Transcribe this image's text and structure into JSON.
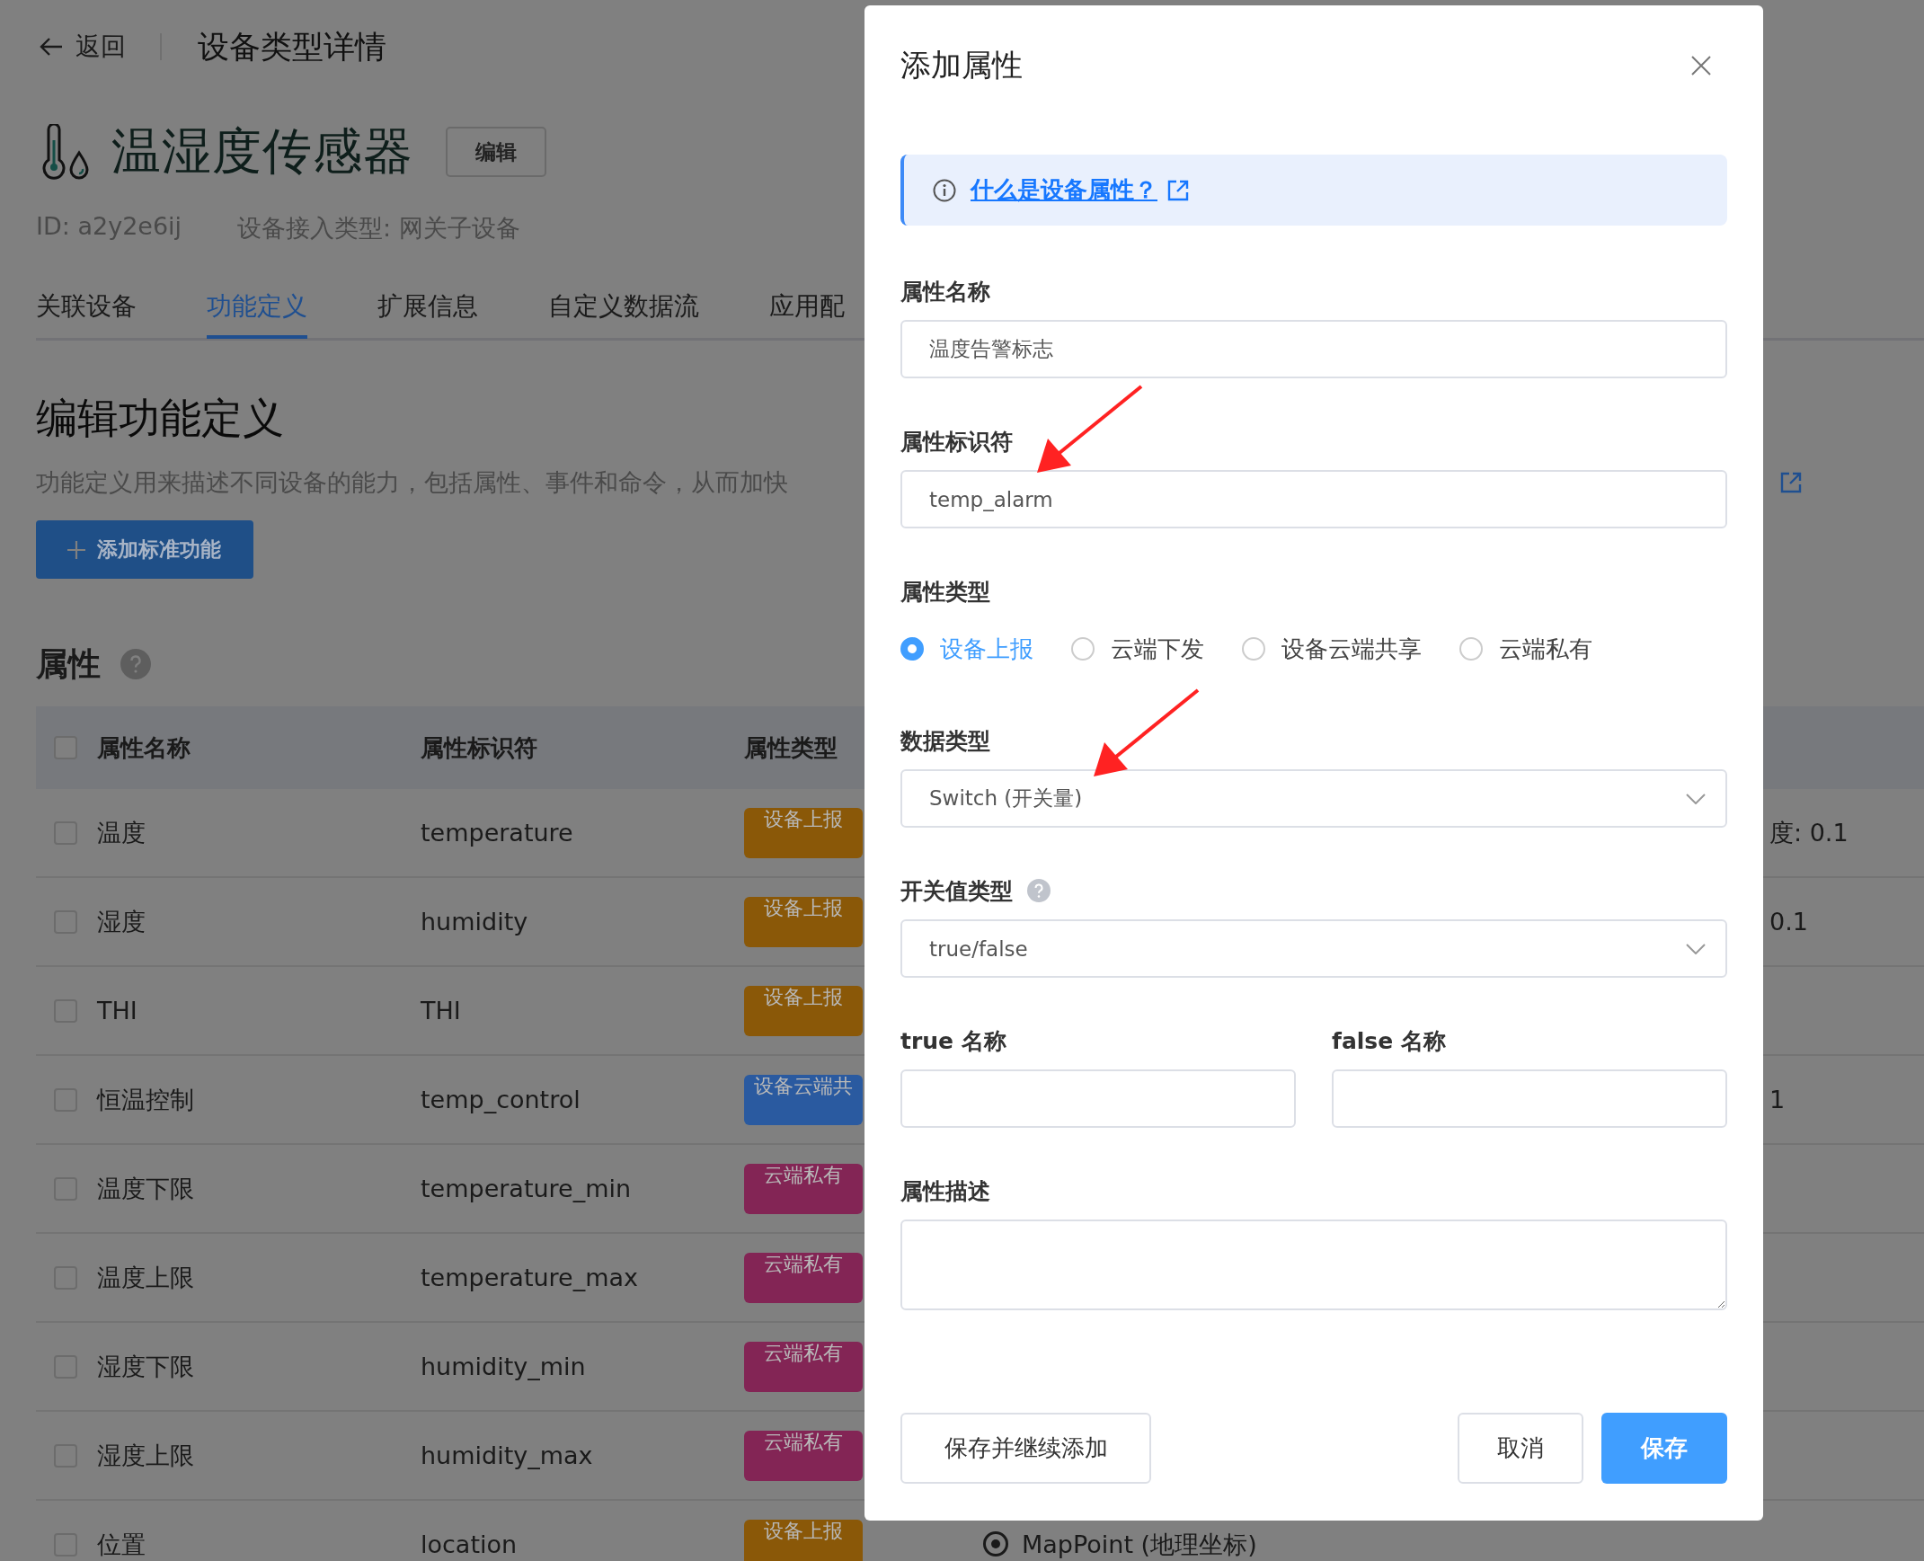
{
  "header": {
    "back": "返回",
    "title": "设备类型详情"
  },
  "device": {
    "name": "温湿度传感器",
    "edit_button": "编辑",
    "id": "ID: a2y2e6ij",
    "access_type": "设备接入类型: 网关子设备"
  },
  "tabs": [
    {
      "label": "关联设备",
      "selected": false
    },
    {
      "label": "功能定义",
      "selected": true
    },
    {
      "label": "扩展信息",
      "selected": false
    },
    {
      "label": "自定义数据流",
      "selected": false
    },
    {
      "label": "应用配",
      "selected": false
    }
  ],
  "section": {
    "title": "编辑功能定义",
    "description": "功能定义用来描述不同设备的能力，包括属性、事件和命令，从而加快",
    "add_button": "添加标准功能"
  },
  "properties": {
    "title": "属性",
    "select_all_checked": false,
    "columns": [
      "属性名称",
      "属性标识符",
      "属性类型"
    ],
    "rows": [
      {
        "checked": false,
        "name": "温度",
        "identifier": "temperature",
        "type": "设备上报",
        "color": "#8a5808",
        "column_4": {
          "kind": "fragment",
          "text": "度: 0.1"
        }
      },
      {
        "checked": false,
        "name": "湿度",
        "identifier": "humidity",
        "type": "设备上报",
        "color": "#8a5808",
        "column_4": {
          "kind": "fragment",
          "text": "0.1"
        }
      },
      {
        "checked": false,
        "name": "THI",
        "identifier": "THI",
        "type": "设备上报",
        "color": "#8a5808"
      },
      {
        "checked": false,
        "name": "恒温控制",
        "identifier": "temp_control",
        "type": "设备云端共",
        "color": "#2a5aa0",
        "column_4": {
          "kind": "fragment",
          "text": "1"
        }
      },
      {
        "checked": false,
        "name": "温度下限",
        "identifier": "temperature_min",
        "type": "云端私有",
        "color": "#832555"
      },
      {
        "checked": false,
        "name": "温度上限",
        "identifier": "temperature_max",
        "type": "云端私有",
        "color": "#832555"
      },
      {
        "checked": false,
        "name": "湿度下限",
        "identifier": "humidity_min",
        "type": "云端私有",
        "color": "#832555"
      },
      {
        "checked": false,
        "name": "湿度上限",
        "identifier": "humidity_max",
        "type": "云端私有",
        "color": "#832555"
      },
      {
        "checked": false,
        "name": "位置",
        "identifier": "location",
        "type": "设备上报",
        "color": "#8a5808",
        "column_4": {
          "kind": "location",
          "text": "MapPoint (地理坐标)"
        }
      }
    ]
  },
  "dialog": {
    "title": "添加属性",
    "help_link": "什么是设备属性？",
    "fields": [
      {
        "kind": "input",
        "label": "属性名称",
        "value": "温度告警标志"
      },
      {
        "kind": "input",
        "label": "属性标识符",
        "value": "temp_alarm",
        "arrow": true
      },
      {
        "kind": "radio",
        "label": "属性类型",
        "options": [
          {
            "label": "设备上报",
            "selected": true
          },
          {
            "label": "云端下发",
            "selected": false
          },
          {
            "label": "设备云端共享",
            "selected": false
          },
          {
            "label": "云端私有",
            "selected": false
          }
        ]
      },
      {
        "kind": "select",
        "label": "数据类型",
        "value": "Switch (开关量)",
        "arrow": true
      },
      {
        "kind": "select",
        "label": "开关值类型",
        "help": true,
        "value": "true/false"
      },
      {
        "kind": "pair",
        "items": [
          {
            "label": "true 名称"
          },
          {
            "label": "false 名称"
          }
        ]
      },
      {
        "kind": "textarea",
        "label": "属性描述"
      }
    ],
    "buttons": [
      {
        "label": "保存并继续添加",
        "kind": "default"
      },
      {
        "label": "取消",
        "kind": "default"
      },
      {
        "label": "保存",
        "kind": "primary"
      }
    ]
  }
}
